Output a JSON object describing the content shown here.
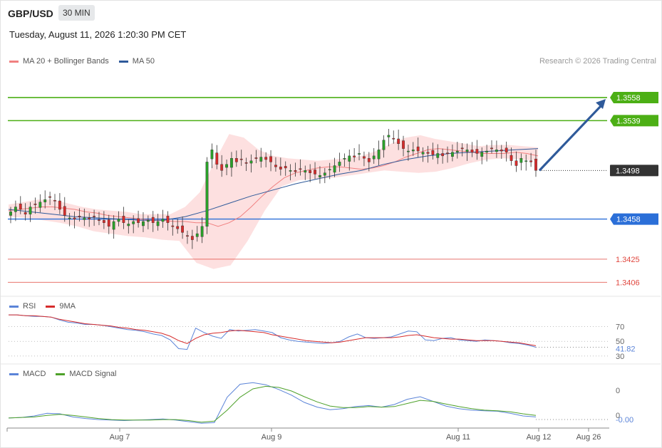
{
  "header": {
    "pair": "GBP/USD",
    "timeframe": "30 MIN",
    "datetime": "Tuesday, August 11, 2026 1:20:30 PM CET",
    "credit": "Research © 2026 Trading Central"
  },
  "colors": {
    "green_level": "#4caf15",
    "blue_level": "#2b6fd8",
    "red_level": "#e0463e",
    "price_label": "#333333",
    "bollinger": "#fcd6d6",
    "ma20": "#f08080",
    "ma50": "#2f5a9a",
    "arrow": "#2f5a9a",
    "candle_up": "#2aa02a",
    "candle_down": "#d62c2c",
    "rsi": "#5b84d8",
    "rsi_ma": "#d62c2c",
    "macd": "#5b84d8",
    "macd_signal": "#4ea12a"
  },
  "chart_data": [
    {
      "type": "candlestick",
      "name": "price",
      "legend": [
        {
          "name": "MA 20 + Bollinger Bands",
          "color": "#f08080"
        },
        {
          "name": "MA 50",
          "color": "#2f5a9a"
        }
      ],
      "levels": [
        {
          "value": 1.3558,
          "label": "1.3558",
          "kind": "resistance"
        },
        {
          "value": 1.3539,
          "label": "1.3539",
          "kind": "resistance"
        },
        {
          "value": 1.3498,
          "label": "1.3498",
          "kind": "last_price"
        },
        {
          "value": 1.3458,
          "label": "1.3458",
          "kind": "pivot"
        },
        {
          "value": 1.3425,
          "label": "1.3425",
          "kind": "support"
        },
        {
          "value": 1.3406,
          "label": "1.3406",
          "kind": "support"
        }
      ],
      "price_path": [
        1.3464,
        1.3468,
        1.3466,
        1.3462,
        1.3468,
        1.347,
        1.3472,
        1.3474,
        1.3476,
        1.3473,
        1.3466,
        1.3461,
        1.3459,
        1.3458,
        1.346,
        1.3459,
        1.3458,
        1.346,
        1.3457,
        1.3455,
        1.3452,
        1.3456,
        1.3458,
        1.3455,
        1.3454,
        1.3456,
        1.3455,
        1.3456,
        1.3457,
        1.3455,
        1.3456,
        1.3458,
        1.3455,
        1.3452,
        1.345,
        1.3447,
        1.3444,
        1.3441,
        1.3446,
        1.3452,
        1.3505,
        1.3515,
        1.3503,
        1.3498,
        1.3503,
        1.3508,
        1.3505,
        1.3507,
        1.3504,
        1.3506,
        1.3508,
        1.3509,
        1.3507,
        1.3505,
        1.3501,
        1.3499,
        1.35,
        1.3498,
        1.3497,
        1.3499,
        1.3498,
        1.3496,
        1.3495,
        1.3494,
        1.3496,
        1.3499,
        1.3502,
        1.3505,
        1.3508,
        1.351,
        1.3509,
        1.3512,
        1.3508,
        1.3505,
        1.351,
        1.3515,
        1.3523,
        1.3527,
        1.3524,
        1.352,
        1.3516,
        1.3514,
        1.3515,
        1.3514,
        1.3513,
        1.3512,
        1.3511,
        1.3512,
        1.351,
        1.3512,
        1.3513,
        1.3514,
        1.3516,
        1.3515,
        1.3513,
        1.3512,
        1.3513,
        1.3514,
        1.3516,
        1.3515,
        1.3514,
        1.3513,
        1.3506,
        1.3502,
        1.3508,
        1.3506,
        1.3505,
        1.3498
      ],
      "ma20_path": [
        1.3465,
        1.3466,
        1.3467,
        1.3468,
        1.3468,
        1.3467,
        1.3466,
        1.3464,
        1.3463,
        1.3461,
        1.346,
        1.3459,
        1.3458,
        1.3457,
        1.3457,
        1.3456,
        1.3456,
        1.3455,
        1.3455,
        1.3452,
        1.3455,
        1.346,
        1.3468,
        1.3477,
        1.3485,
        1.3492,
        1.3496,
        1.3498,
        1.35,
        1.3501,
        1.3501,
        1.35,
        1.3499,
        1.35,
        1.3502,
        1.3505,
        1.3509,
        1.3512,
        1.3515,
        1.3516,
        1.3515,
        1.3514,
        1.3513,
        1.3512,
        1.3512,
        1.3512,
        1.3513,
        1.3512,
        1.351
      ],
      "bb_upper_path": [
        1.347,
        1.3472,
        1.3474,
        1.3474,
        1.3471,
        1.3468,
        1.3466,
        1.3465,
        1.3464,
        1.3462,
        1.3462,
        1.3462,
        1.3468,
        1.348,
        1.3505,
        1.3528,
        1.3525,
        1.3515,
        1.351,
        1.3508,
        1.3507,
        1.3506,
        1.3507,
        1.3508,
        1.351,
        1.3514,
        1.352,
        1.3525,
        1.3527,
        1.3524,
        1.3522,
        1.352,
        1.3518,
        1.3519,
        1.3519,
        1.3518,
        1.3517
      ],
      "bb_lower_path": [
        1.346,
        1.3459,
        1.3457,
        1.3455,
        1.3452,
        1.3448,
        1.3446,
        1.3444,
        1.3443,
        1.3441,
        1.344,
        1.3422,
        1.3417,
        1.342,
        1.344,
        1.3465,
        1.3485,
        1.349,
        1.3491,
        1.3492,
        1.3494,
        1.3496,
        1.3498,
        1.3497,
        1.3496,
        1.3497,
        1.35,
        1.3504,
        1.3507,
        1.3508,
        1.3507,
        1.3506
      ],
      "ma50_path": [
        1.3466,
        1.3464,
        1.3462,
        1.346,
        1.3459,
        1.3458,
        1.3457,
        1.3457,
        1.346,
        1.3465,
        1.3471,
        1.3477,
        1.3482,
        1.3487,
        1.3491,
        1.3495,
        1.3498,
        1.3503,
        1.3507,
        1.351,
        1.3512,
        1.3513,
        1.3514,
        1.3515,
        1.3516
      ],
      "projection": {
        "from": 1.3498,
        "to": 1.3558
      },
      "ylim": [
        1.3398,
        1.3582
      ]
    },
    {
      "type": "line",
      "name": "rsi",
      "legend": [
        {
          "name": "RSI",
          "color": "#5b84d8"
        },
        {
          "name": "9MA",
          "color": "#d62c2c"
        }
      ],
      "y_ticks": [
        70,
        50,
        30
      ],
      "y_tick_labels": [
        "70",
        "50",
        "30"
      ],
      "current": {
        "value": 41.82,
        "label": "41.82"
      },
      "series": [
        {
          "key": "rsi",
          "values": [
            86,
            86,
            85,
            84,
            84,
            83,
            79,
            76,
            75,
            73,
            73,
            72,
            70,
            68,
            66,
            65,
            63,
            60,
            58,
            52,
            40,
            39,
            68,
            62,
            57,
            54,
            66,
            64,
            65,
            66,
            64,
            62,
            55,
            52,
            50,
            49,
            48,
            47,
            48,
            50,
            56,
            60,
            55,
            54,
            55,
            56,
            60,
            64,
            63,
            52,
            51,
            54,
            55,
            52,
            51,
            50,
            52,
            51,
            50,
            48,
            47,
            45,
            42
          ]
        },
        {
          "key": "rsi_ma",
          "values": [
            86,
            86,
            85,
            85,
            84,
            83,
            80,
            78,
            76,
            74,
            73,
            72,
            71,
            69,
            68,
            66,
            65,
            63,
            61,
            57,
            51,
            47,
            54,
            59,
            61,
            62,
            64,
            65,
            64,
            63,
            62,
            59,
            57,
            55,
            53,
            51,
            50,
            49,
            48,
            49,
            51,
            53,
            55,
            55,
            55,
            55,
            56,
            58,
            59,
            57,
            55,
            54,
            53,
            53,
            52,
            51,
            51,
            51,
            50,
            49,
            48,
            46,
            44
          ]
        }
      ],
      "ylim": [
        25,
        90
      ]
    },
    {
      "type": "line",
      "name": "macd",
      "legend": [
        {
          "name": "MACD",
          "color": "#5b84d8"
        },
        {
          "name": "MACD Signal",
          "color": "#4ea12a"
        }
      ],
      "y_ticks": [
        0,
        0
      ],
      "y_tick_labels": [
        "0",
        "0"
      ],
      "current": {
        "value": -0.0,
        "label": "-0.00"
      },
      "series": [
        {
          "key": "macd",
          "values": [
            0.0,
            0.1,
            0.4,
            0.9,
            0.8,
            0.2,
            -0.1,
            -0.3,
            -0.4,
            -0.5,
            -0.4,
            -0.3,
            -0.2,
            -0.4,
            -0.7,
            -1.0,
            -0.9,
            4.0,
            6.5,
            6.8,
            6.4,
            5.5,
            4.4,
            3.0,
            2.1,
            1.6,
            1.8,
            2.2,
            2.4,
            2.1,
            2.6,
            3.6,
            4.1,
            3.2,
            2.3,
            1.8,
            1.5,
            1.4,
            1.3,
            0.9,
            0.4,
            0.2
          ]
        },
        {
          "key": "signal",
          "values": [
            0.0,
            0.1,
            0.2,
            0.5,
            0.7,
            0.5,
            0.2,
            -0.1,
            -0.3,
            -0.4,
            -0.4,
            -0.4,
            -0.3,
            -0.3,
            -0.5,
            -0.8,
            -0.6,
            1.5,
            4.0,
            5.6,
            6.1,
            5.9,
            5.2,
            4.1,
            3.1,
            2.3,
            2.0,
            2.0,
            2.2,
            2.1,
            2.2,
            2.8,
            3.4,
            3.2,
            2.7,
            2.2,
            1.8,
            1.5,
            1.4,
            1.2,
            0.8,
            0.5
          ]
        }
      ],
      "ylim": [
        -1.8,
        7.8
      ]
    }
  ],
  "x_axis": {
    "ticks": [
      "Aug 7",
      "Aug 9",
      "Aug 11",
      "Aug 12",
      "Aug 26"
    ]
  }
}
